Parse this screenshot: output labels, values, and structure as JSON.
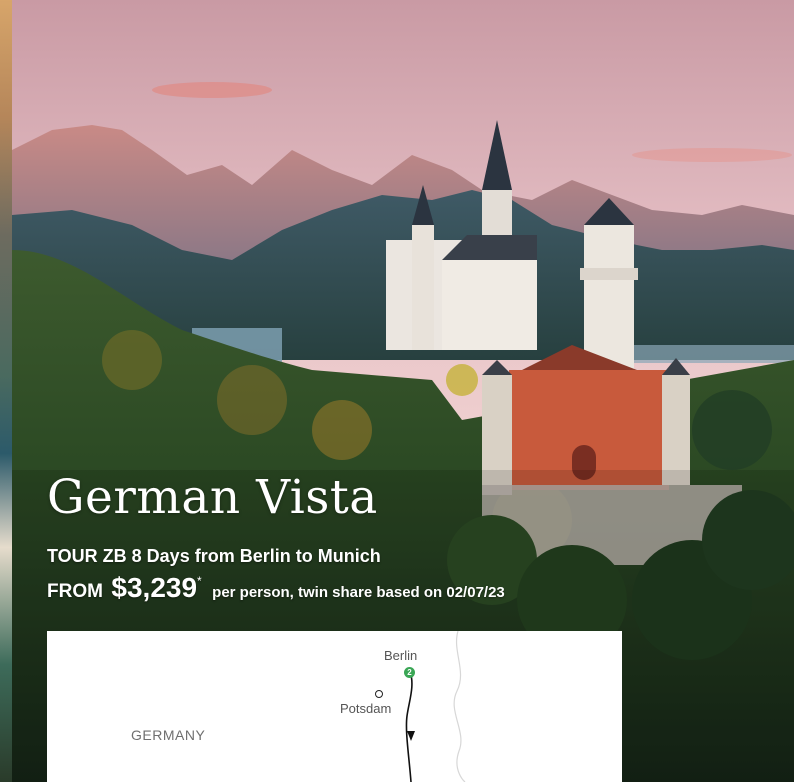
{
  "tour": {
    "name": "German Vista",
    "code_line": "TOUR ZB 8 Days from Berlin to Munich",
    "from_label": "FROM",
    "price": "$3,239",
    "price_mark": "*",
    "price_note": "per person, twin share based on 02/07/23"
  },
  "map": {
    "cities": [
      {
        "name": "Berlin",
        "stop": "2"
      },
      {
        "name": "Potsdam"
      }
    ],
    "country": "GERMANY"
  },
  "colors": {
    "route_stop": "#3aa655",
    "text": "#ffffff"
  }
}
